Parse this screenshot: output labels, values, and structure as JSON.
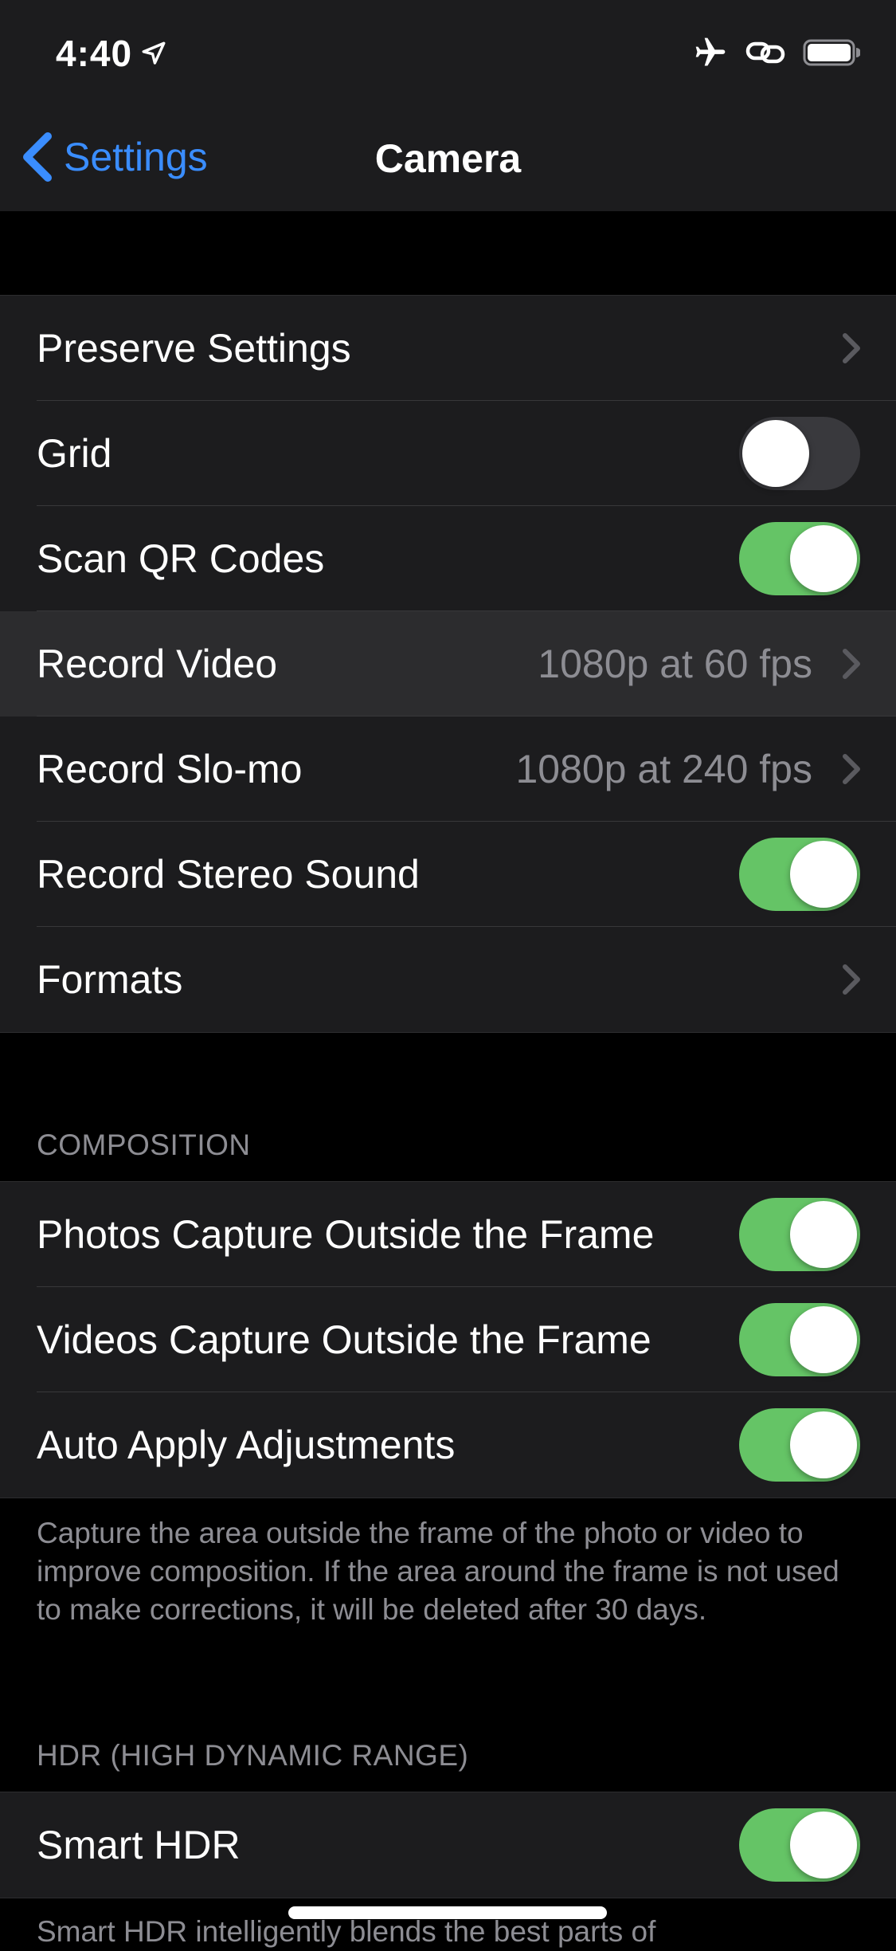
{
  "status_bar": {
    "time": "4:40",
    "icons": [
      "location-arrow-icon",
      "airplane-icon",
      "link-icon",
      "battery-icon"
    ]
  },
  "nav": {
    "back_label": "Settings",
    "title": "Camera"
  },
  "group1": {
    "preserve_settings": "Preserve Settings",
    "grid": "Grid",
    "scan_qr": "Scan QR Codes",
    "record_video": "Record Video",
    "record_video_value": "1080p at 60 fps",
    "record_slomo": "Record Slo-mo",
    "record_slomo_value": "1080p at 240 fps",
    "record_stereo": "Record Stereo Sound",
    "formats": "Formats"
  },
  "toggles": {
    "grid": false,
    "scan_qr": true,
    "record_stereo": true,
    "photos_capture": true,
    "videos_capture": true,
    "auto_apply": true,
    "smart_hdr": true
  },
  "composition": {
    "header": "COMPOSITION",
    "photos_capture": "Photos Capture Outside the Frame",
    "videos_capture": "Videos Capture Outside the Frame",
    "auto_apply": "Auto Apply Adjustments",
    "footer": "Capture the area outside the frame of the photo or video to improve composition. If the area around the frame is not used to make corrections, it will be deleted after 30 days."
  },
  "hdr": {
    "header": "HDR (HIGH DYNAMIC RANGE)",
    "smart_hdr": "Smart HDR",
    "footer_partial": "Smart HDR intelligently blends the best parts of"
  },
  "colors": {
    "accent": "#3a8dff",
    "toggle_on": "#65c466",
    "toggle_off": "#39393d",
    "cell_background": "#1c1c1e",
    "page_background": "#000000",
    "secondary_text": "#8d8d93"
  }
}
